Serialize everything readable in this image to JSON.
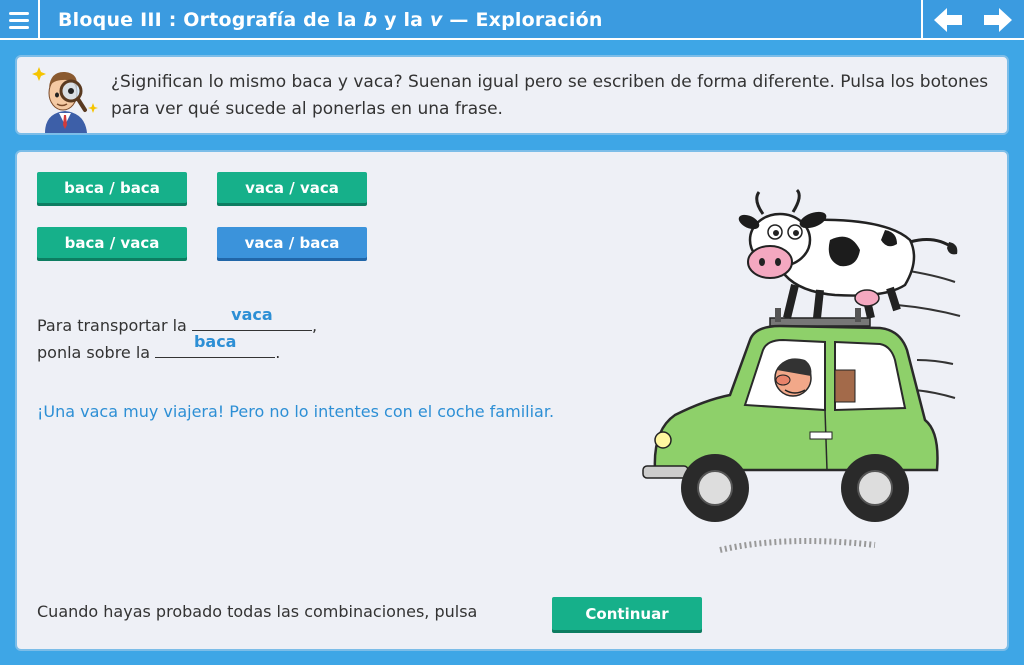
{
  "header": {
    "title_prefix": "Bloque III : Ortografía de la ",
    "title_b": "b",
    "title_mid": " y la ",
    "title_v": "v",
    "title_suffix": " — Exploración",
    "menu_icon": "hamburger-menu-icon",
    "prev_icon": "arrow-left-icon",
    "next_icon": "arrow-right-icon"
  },
  "instruction": {
    "text": "¿Significan lo mismo baca y vaca? Suenan igual pero se escriben de forma diferente. Pulsa los botones para ver qué sucede al ponerlas en una frase.",
    "avatar_icon": "detective-with-magnifier-icon"
  },
  "buttons": {
    "b1": "baca / baca",
    "b2": "vaca / vaca",
    "b3": "baca / vaca",
    "b4": "vaca / baca",
    "selected": "vaca / baca"
  },
  "sentence": {
    "line1_before": "Para transportar la ",
    "line1_word": "vaca",
    "line1_after": ",",
    "line2_before": "ponla sobre la ",
    "line2_word": "baca",
    "line2_after": "."
  },
  "feedback": "¡Una vaca muy viajera! Pero no lo intentes con el coche familiar.",
  "footer": {
    "text": "Cuando hayas probado todas las combinaciones, pulsa",
    "continue_label": "Continuar"
  },
  "colors": {
    "header_bg": "#3b9be0",
    "button_green": "#16b08a",
    "button_blue": "#3b93db",
    "accent_text": "#2d8fd5"
  }
}
